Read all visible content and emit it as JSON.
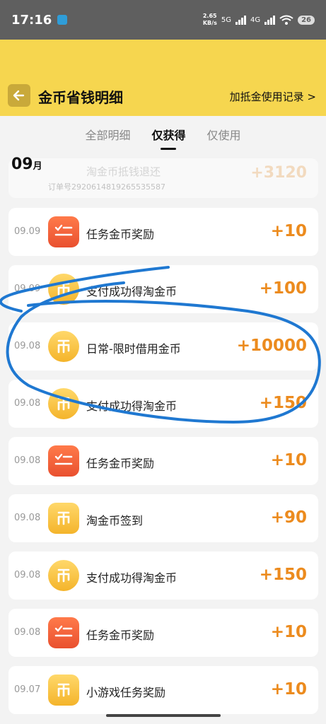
{
  "status": {
    "time": "17:16",
    "speed_value": "2.65",
    "speed_unit": "KB/s",
    "net1": "5G",
    "net2": "4G",
    "battery": "26"
  },
  "header": {
    "title": "金币省钱明细",
    "records_link": "加抵金使用记录 >"
  },
  "tabs": [
    {
      "label": "全部明细"
    },
    {
      "label": "仅获得"
    },
    {
      "label": "仅使用"
    }
  ],
  "month": {
    "num": "09",
    "unit": "月"
  },
  "partial_item": {
    "title": "淘金币抵钱退还",
    "subtitle": "订单号2920614819265535587",
    "amount": "+3120"
  },
  "items": [
    {
      "date": "09.09",
      "icon": "task-icon",
      "title": "任务金币奖励",
      "amount": "+10"
    },
    {
      "date": "09.09",
      "icon": "coin-icon",
      "title": "支付成功得淘金币",
      "amount": "+100"
    },
    {
      "date": "09.08",
      "icon": "coin-icon",
      "title": "日常-限时借用金币",
      "amount": "+10000"
    },
    {
      "date": "09.08",
      "icon": "coin-icon",
      "title": "支付成功得淘金币",
      "amount": "+150"
    },
    {
      "date": "09.08",
      "icon": "task-icon",
      "title": "任务金币奖励",
      "amount": "+10"
    },
    {
      "date": "09.08",
      "icon": "coin-icon",
      "title": "淘金币签到",
      "amount": "+90"
    },
    {
      "date": "09.08",
      "icon": "coin-icon",
      "title": "支付成功得淘金币",
      "amount": "+150"
    },
    {
      "date": "09.08",
      "icon": "task-icon",
      "title": "任务金币奖励",
      "amount": "+10"
    },
    {
      "date": "09.07",
      "icon": "coin-icon",
      "title": "小游戏任务奖励",
      "amount": "+10"
    }
  ],
  "colors": {
    "header_bg": "#f6d64f",
    "amount": "#ec8b1e",
    "annotation_stroke": "#1f78d1"
  }
}
